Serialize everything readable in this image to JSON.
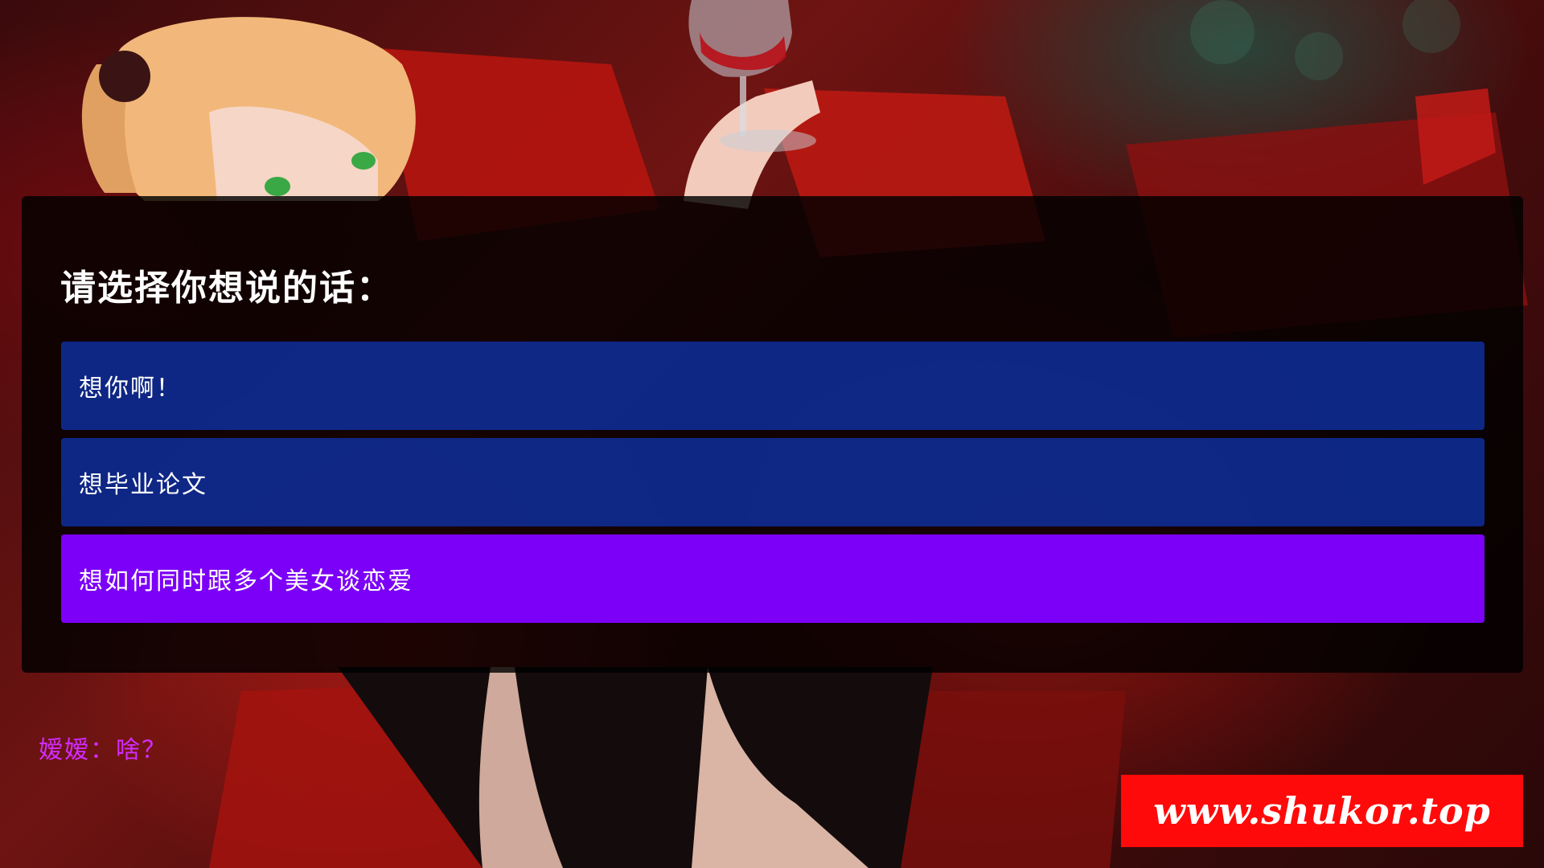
{
  "menu": {
    "prompt": "请选择你想说的话：",
    "options": [
      {
        "label": "想你啊！",
        "state": "normal"
      },
      {
        "label": "想毕业论文",
        "state": "normal"
      },
      {
        "label": "想如何同时跟多个美女谈恋爱",
        "state": "hover"
      }
    ]
  },
  "dialogue": {
    "speaker": "嫒嫒",
    "separator": "：",
    "line": "啥？",
    "color": "#d12cff"
  },
  "watermark": {
    "text": "www.shukor.top",
    "background": "#ff0a0a"
  },
  "colors": {
    "option_normal": "#0e32aa",
    "option_hover": "#8000ff",
    "panel": "#000000"
  }
}
